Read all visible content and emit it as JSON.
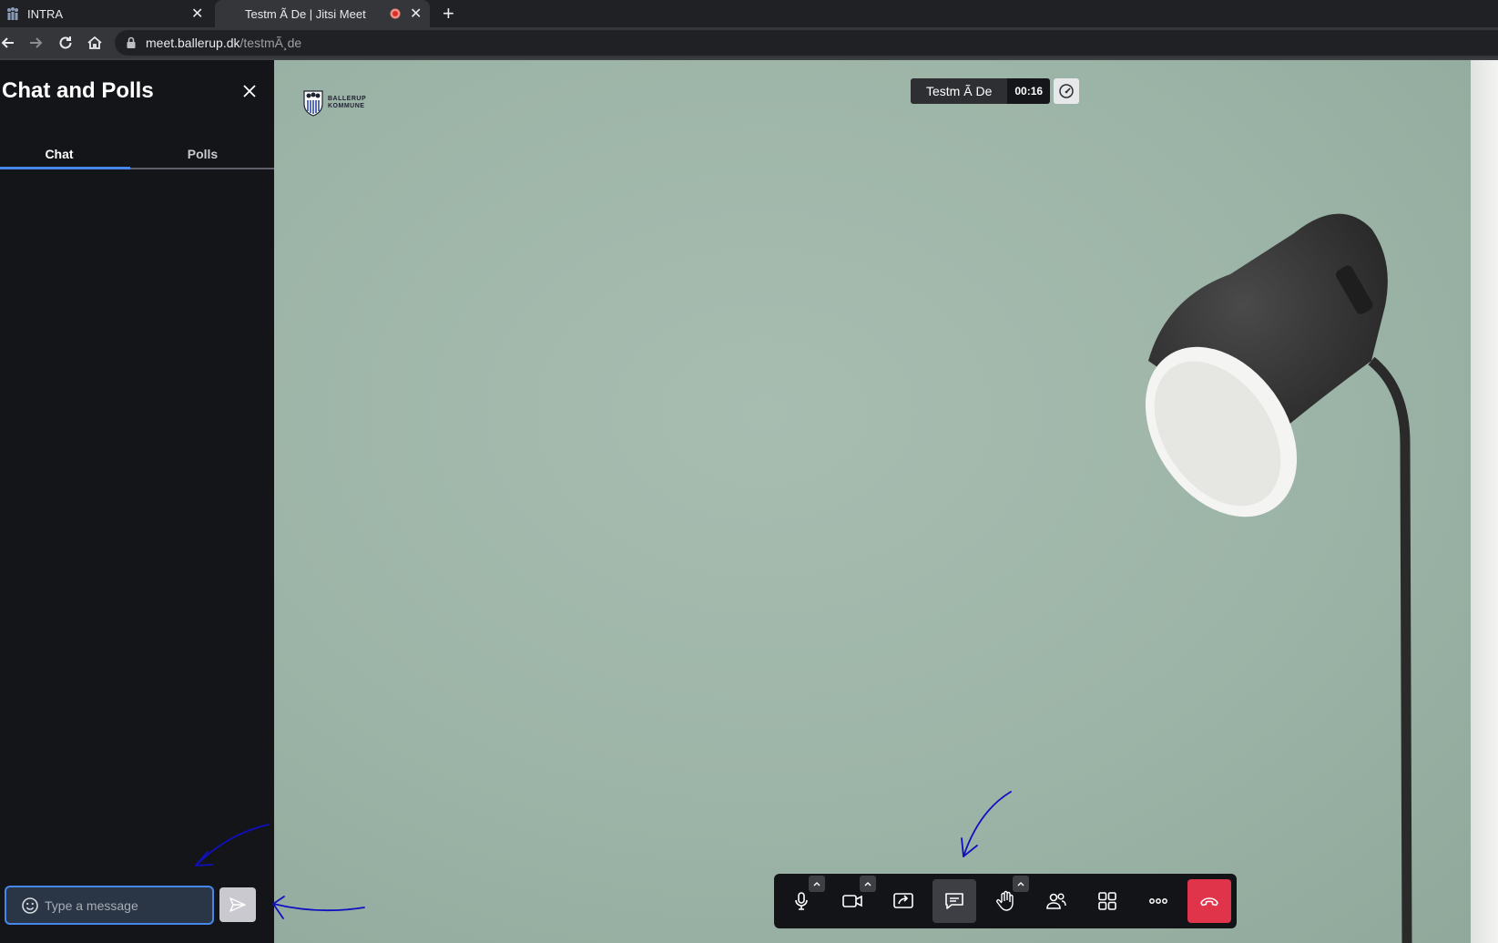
{
  "browser": {
    "tabs": [
      {
        "title": "INTRA"
      },
      {
        "title": "Testm Ã De | Jitsi Meet"
      }
    ],
    "new_tab_label": "+",
    "url_host": "meet.ballerup.dk",
    "url_path": "/testmÃ¸de"
  },
  "sidebar": {
    "title": "Chat and Polls",
    "tabs": [
      {
        "label": "Chat"
      },
      {
        "label": "Polls"
      }
    ],
    "message_placeholder": "Type a message"
  },
  "meeting": {
    "name": "Testm Ã De",
    "timer": "00:16",
    "logo_line1": "BALLERUP",
    "logo_line2": "KOMMUNE"
  },
  "toolbar": {
    "buttons": [
      {
        "icon": "microphone-icon"
      },
      {
        "icon": "camera-icon"
      },
      {
        "icon": "screen-share-icon"
      },
      {
        "icon": "chat-icon"
      },
      {
        "icon": "raise-hand-icon"
      },
      {
        "icon": "participants-icon"
      },
      {
        "icon": "tile-view-icon"
      },
      {
        "icon": "more-options-icon"
      },
      {
        "icon": "hang-up-icon"
      }
    ]
  },
  "colors": {
    "accent": "#4687ed",
    "hangup": "#e0344b",
    "annotation": "#1010c0"
  }
}
